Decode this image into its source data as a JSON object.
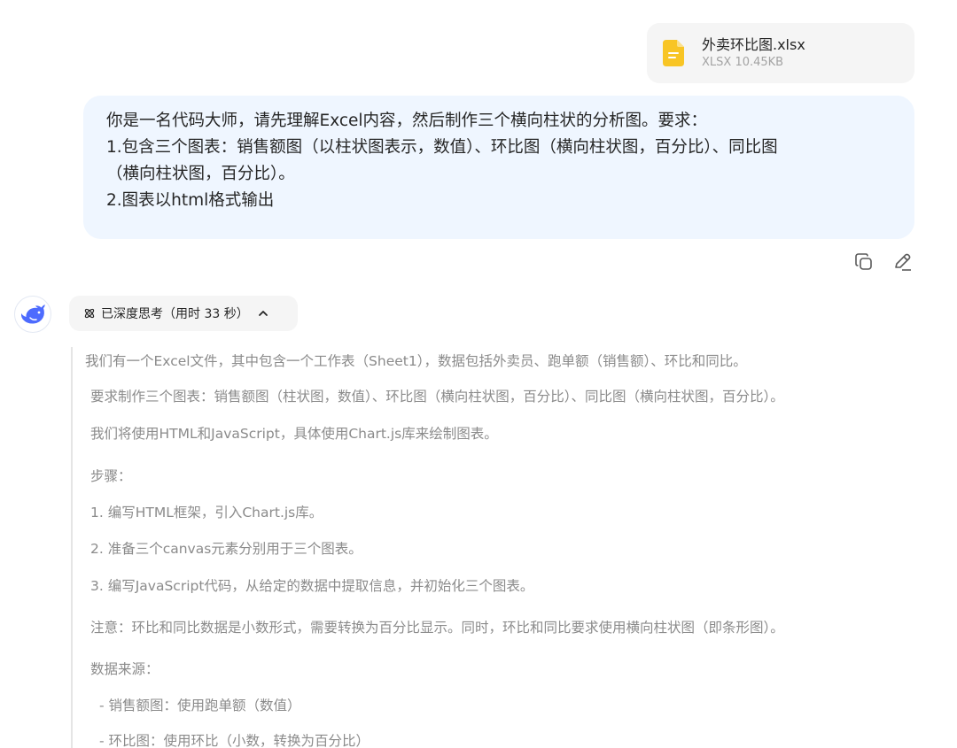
{
  "attachment": {
    "file_name": "外卖环比图.xlsx",
    "file_meta": "XLSX 10.45KB",
    "icon": "file-document-icon",
    "icon_color": "#f8c525"
  },
  "user_message": {
    "lines": [
      "你是一名代码大师，请先理解Excel内容，然后制作三个横向柱状的分析图。要求：",
      "1.包含三个图表：销售额图（以柱状图表示，数值）、环比图（横向柱状图，百分比）、同比图",
      "（横向柱状图，百分比）。",
      "2.图表以html格式输出"
    ],
    "bubble_color": "#eff6ff"
  },
  "message_actions": {
    "copy_icon": "copy-icon",
    "edit_icon": "edit-pencil-icon"
  },
  "assistant": {
    "avatar_icon": "whale-logo-icon",
    "brand_color": "#4d6bfe",
    "thinking_label": "已深度思考（用时 33 秒）",
    "thinking_icon": "atom-icon",
    "toggle_icon": "chevron-up-icon",
    "reasoning": [
      "我们有一个Excel文件，其中包含一个工作表（Sheet1），数据包括外卖员、跑单额（销售额）、环比和同比。",
      "要求制作三个图表：销售额图（柱状图，数值）、环比图（横向柱状图，百分比）、同比图（横向柱状图，百分比）。",
      "我们将使用HTML和JavaScript，具体使用Chart.js库来绘制图表。",
      "步骤：",
      "1. 编写HTML框架，引入Chart.js库。",
      "2. 准备三个canvas元素分别用于三个图表。",
      "3. 编写JavaScript代码，从给定的数据中提取信息，并初始化三个图表。",
      "注意：环比和同比数据是小数形式，需要转换为百分比显示。同时，环比和同比要求使用横向柱状图（即条形图）。",
      "数据来源：",
      "- 销售额图：使用跑单额（数值）",
      "- 环比图：使用环比（小数，转换为百分比）"
    ]
  }
}
